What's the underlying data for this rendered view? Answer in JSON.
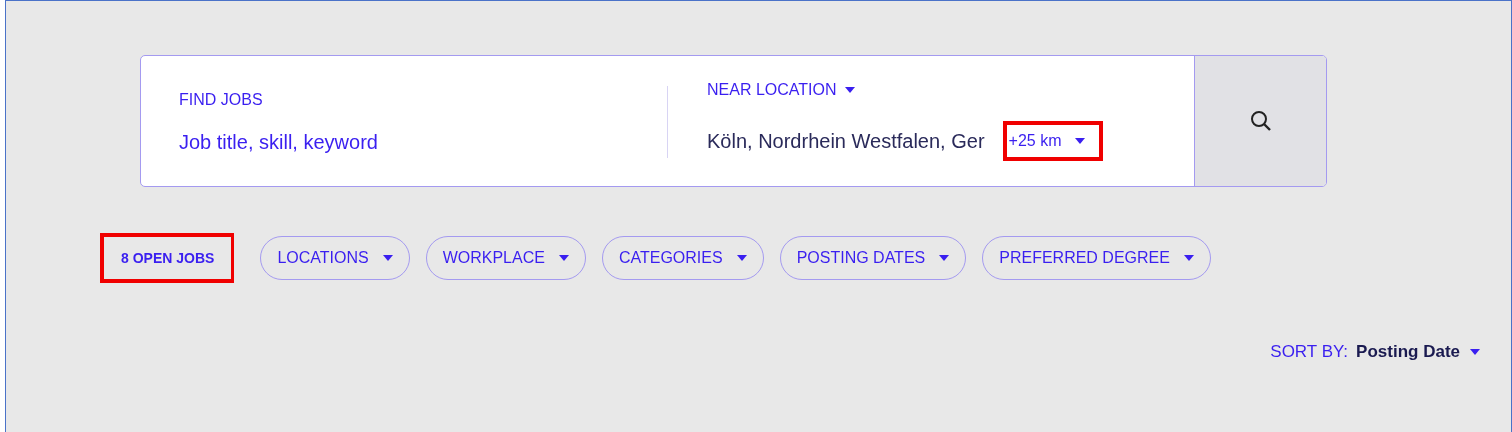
{
  "search": {
    "keyword": {
      "label": "FIND JOBS",
      "placeholder": "Job title, skill, keyword"
    },
    "location": {
      "label": "NEAR LOCATION",
      "value": "Köln, Nordrhein Westfalen, Ger",
      "distance": "+25 km",
      "distance_highlighted": true
    }
  },
  "results": {
    "count": "8 OPEN JOBS",
    "highlighted": true
  },
  "filters": [
    {
      "label": "LOCATIONS"
    },
    {
      "label": "WORKPLACE"
    },
    {
      "label": "CATEGORIES"
    },
    {
      "label": "POSTING DATES"
    },
    {
      "label": "PREFERRED DEGREE"
    }
  ],
  "sort": {
    "label": "SORT BY:",
    "value": "Posting Date"
  }
}
